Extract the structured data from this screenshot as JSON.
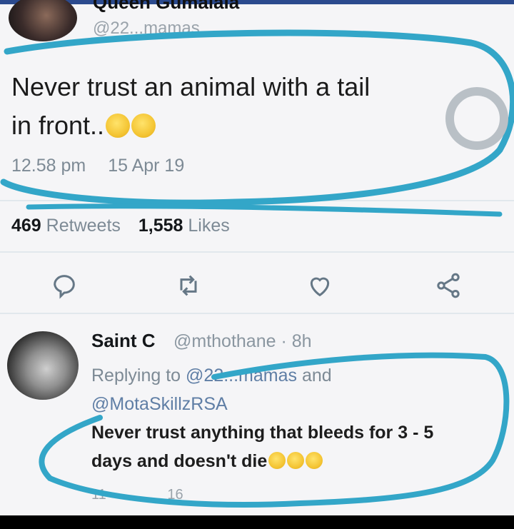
{
  "top_tweet": {
    "author_name": "Queen Gumalala",
    "handle": "@22...mamas",
    "text_line1": "Never trust an animal with a tail",
    "text_line2": "in front..",
    "time": "12.58 pm",
    "date": "15 Apr 19",
    "retweets_count": "469",
    "retweets_label": "Retweets",
    "likes_count": "1,558",
    "likes_label": "Likes"
  },
  "actions": {
    "reply_icon": "comment-icon",
    "retweet_icon": "retweet-icon",
    "like_icon": "heart-icon",
    "share_icon": "share-icon"
  },
  "reply_tweet": {
    "author_name": "Saint C",
    "handle": "@mthothane · 8h",
    "replying_prefix": "Replying to",
    "replying_user1": "@22...mamas",
    "replying_and": "and",
    "replying_user2": "@MotaSkillzRSA",
    "text_line1": "Never trust anything that bleeds for 3 - 5",
    "text_line2": "days and doesn't die",
    "reply_count": "11",
    "retweet_count": "16"
  },
  "colors": {
    "accent_scribble": "#33a6c8",
    "text_gray": "#7d8a95"
  }
}
